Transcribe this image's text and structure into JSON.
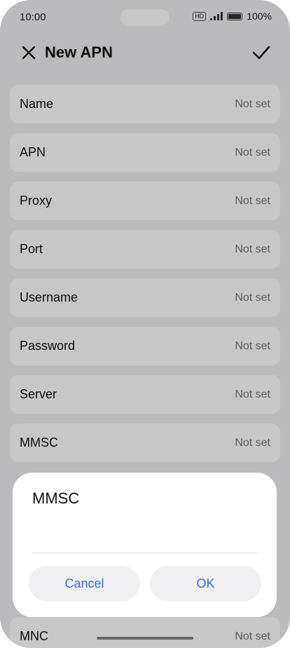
{
  "status": {
    "time": "10:00",
    "hd": "HD",
    "battery": "100%"
  },
  "header": {
    "title": "New APN"
  },
  "fields": [
    {
      "label": "Name",
      "value": "Not set"
    },
    {
      "label": "APN",
      "value": "Not set"
    },
    {
      "label": "Proxy",
      "value": "Not set"
    },
    {
      "label": "Port",
      "value": "Not set"
    },
    {
      "label": "Username",
      "value": "Not set"
    },
    {
      "label": "Password",
      "value": "Not set"
    },
    {
      "label": "Server",
      "value": "Not set"
    },
    {
      "label": "MMSC",
      "value": "Not set"
    }
  ],
  "underlay": {
    "label": "MNC",
    "value": "Not set"
  },
  "dialog": {
    "title": "MMSC",
    "input": "",
    "cancel": "Cancel",
    "ok": "OK"
  },
  "colors": {
    "accent": "#2f6fe0"
  }
}
